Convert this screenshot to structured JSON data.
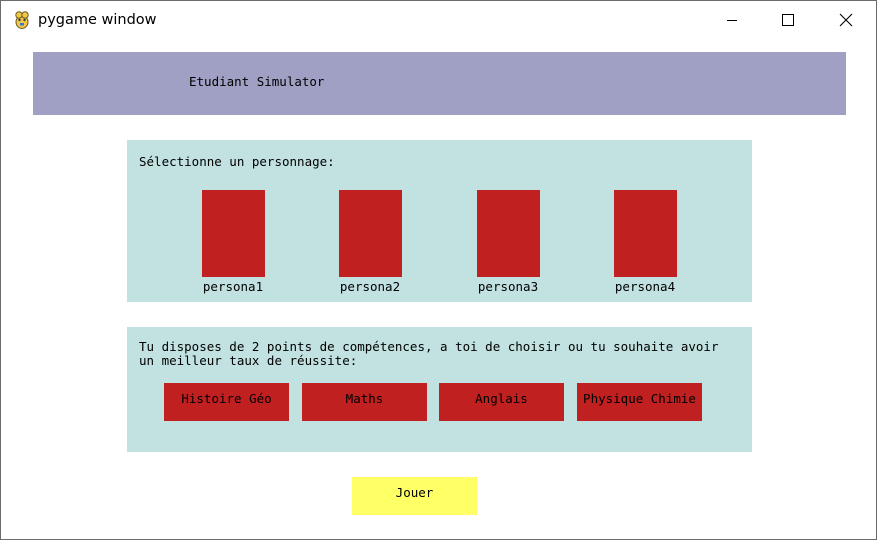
{
  "window": {
    "title": "pygame window"
  },
  "header": {
    "title": "Etudiant Simulator"
  },
  "character_panel": {
    "prompt": "Sélectionne un personnage:",
    "personas": [
      {
        "label": "persona1"
      },
      {
        "label": "persona2"
      },
      {
        "label": "persona3"
      },
      {
        "label": "persona4"
      }
    ]
  },
  "skills_panel": {
    "line1": "Tu disposes de 2 points de compétences, a toi de choisir ou tu souhaite avoir",
    "line2": "un meilleur taux de réussite:",
    "buttons": [
      {
        "label": "Histoire Géo"
      },
      {
        "label": "Maths"
      },
      {
        "label": "Anglais"
      },
      {
        "label": "Physique Chimie"
      }
    ]
  },
  "play_button": {
    "label": "Jouer"
  },
  "colors": {
    "header_bg": "#a0a0c4",
    "panel_bg": "#c2e1e1",
    "red": "#c02020",
    "yellow": "#ffff66"
  }
}
